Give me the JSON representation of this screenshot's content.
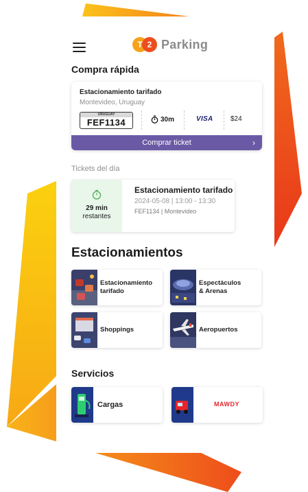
{
  "app": {
    "logo_badge_left": "T",
    "logo_badge_right": "2",
    "logo_text": "Parking"
  },
  "colors": {
    "accent_purple": "#6a5aa6",
    "brand_orange": "#ec4e1d",
    "brand_yellow": "#f6a21a",
    "ticket_green_bg": "#e9f6ea",
    "timer_green": "#4caf50"
  },
  "icons": {
    "menu": "hamburger-menu-icon",
    "timer": "stopwatch-icon",
    "chevron": "chevron-right-icon"
  },
  "quick_buy": {
    "title": "Compra rápida",
    "location_name": "Estacionamiento tarifado",
    "city": "Montevideo, Uruguay",
    "plate_country": "URUGUAY",
    "plate_number": "FEF1134",
    "duration": "30m",
    "payment_brand": "VISA",
    "price": "$24",
    "button_label": "Comprar ticket",
    "button_chevron": "›"
  },
  "tickets": {
    "title": "Tickets del día",
    "items": [
      {
        "remaining_value": "29 min",
        "remaining_label": "restantes",
        "name": "Estacionamiento tarifado",
        "datetime": "2024-05-08 | 13:00 - 13:30",
        "plate_city": "FEF1134 | Montevideo"
      }
    ]
  },
  "parking": {
    "title": "Estacionamientos",
    "categories": [
      {
        "label": "Estacionamiento tarifado"
      },
      {
        "label": "Espectáculos & Arenas"
      },
      {
        "label": "Shoppings"
      },
      {
        "label": "Aeropuertos"
      }
    ]
  },
  "services": {
    "title": "Servicios",
    "items": [
      {
        "label": "Cargas"
      },
      {
        "label": "MAWDY"
      }
    ]
  }
}
